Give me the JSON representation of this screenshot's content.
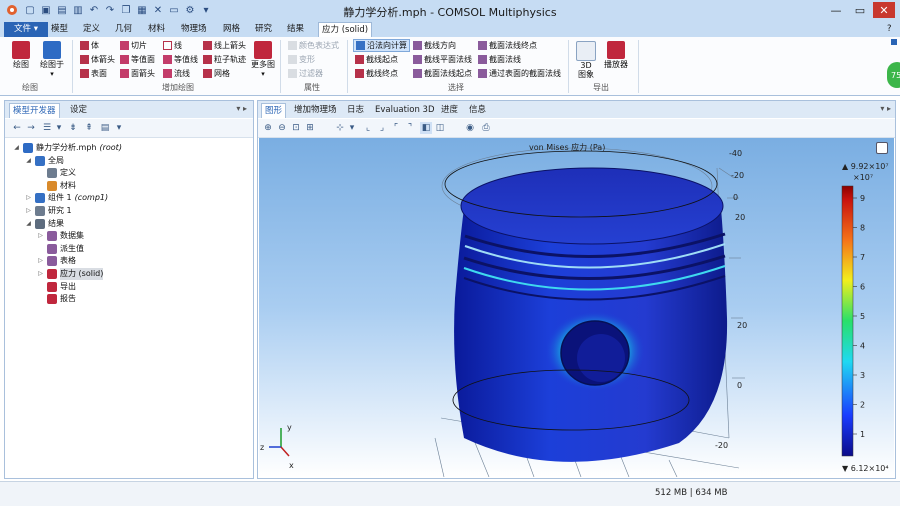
{
  "window": {
    "title": "静力学分析.mph - COMSOL Multiphysics",
    "help_label": "?"
  },
  "menu": {
    "file": "文件 ▾",
    "tabs": [
      "模型",
      "定义",
      "几何",
      "材料",
      "物理场",
      "网格",
      "研究",
      "结果",
      "应力 (solid)"
    ],
    "active_tab": "应力 (solid)"
  },
  "ribbon": {
    "plot_group": {
      "label": "绘图",
      "plot": "绘图",
      "plot_in": "绘图于"
    },
    "add_plot": {
      "label": "增加绘图",
      "col1": [
        "体",
        "体箭头",
        "表面"
      ],
      "col2": [
        "切片",
        "等值面",
        "面箭头"
      ],
      "col3": [
        "线",
        "等值线",
        "流线"
      ],
      "col4": [
        "线上箭头",
        "粒子轨迹",
        "网格"
      ],
      "more": "更多图"
    },
    "props": {
      "label": "属性",
      "items": [
        "颜色表达式",
        "变形",
        "过滤器"
      ]
    },
    "select": {
      "label": "选择",
      "col1": [
        "沿法向计算",
        "截线起点",
        "截线终点"
      ],
      "col2": [
        "截线方向",
        "截线平面法线",
        "截面法线起点"
      ],
      "col3": [
        "截面法线终点",
        "截面法线",
        "通过表面的截面法线"
      ]
    },
    "export": {
      "label": "导出",
      "image3d": "3D\n图象",
      "player": "播放器"
    }
  },
  "left_panel": {
    "tabs": [
      "模型开发器",
      "设定"
    ],
    "tree": [
      {
        "label": "静力学分析.mph",
        "suffix": "(root)",
        "depth": 0,
        "arrow": "◢"
      },
      {
        "label": "全局",
        "depth": 1,
        "arrow": "◢"
      },
      {
        "label": "定义",
        "depth": 2,
        "arrow": ""
      },
      {
        "label": "材料",
        "depth": 2,
        "arrow": ""
      },
      {
        "label": "组件 1",
        "suffix": "(comp1)",
        "depth": 1,
        "arrow": "▷"
      },
      {
        "label": "研究 1",
        "depth": 1,
        "arrow": "▷"
      },
      {
        "label": "结果",
        "depth": 1,
        "arrow": "◢"
      },
      {
        "label": "数据集",
        "depth": 2,
        "arrow": "▷"
      },
      {
        "label": "派生值",
        "depth": 2,
        "arrow": ""
      },
      {
        "label": "表格",
        "depth": 2,
        "arrow": "▷"
      },
      {
        "label": "应力 (solid)",
        "depth": 2,
        "arrow": "▷",
        "selected": true
      },
      {
        "label": "导出",
        "depth": 2,
        "arrow": ""
      },
      {
        "label": "报告",
        "depth": 2,
        "arrow": ""
      }
    ]
  },
  "right_panel": {
    "tabs": [
      "图形",
      "增加物理场",
      "日志",
      "Evaluation 3D",
      "进度",
      "信息"
    ],
    "plot_title": "von Mises 应力 (Pa)",
    "axis_ticks_top": [
      "-40",
      "-20",
      "0",
      "20"
    ],
    "axis_ticks_right": [
      "20",
      "0",
      "-20"
    ],
    "colorbar": {
      "max_label": "▲ 9.92×10⁷",
      "unit": "×10⁷",
      "ticks": [
        "9",
        "8",
        "7",
        "6",
        "5",
        "4",
        "3",
        "2",
        "1"
      ],
      "min_label": "▼ 6.12×10⁴"
    },
    "triad": {
      "x": "x",
      "y": "y",
      "z": "z"
    }
  },
  "status": {
    "memory": "512 MB | 634 MB"
  },
  "colors": {
    "accent": "#2a64b5",
    "titlebar": "#c6dcf3"
  }
}
